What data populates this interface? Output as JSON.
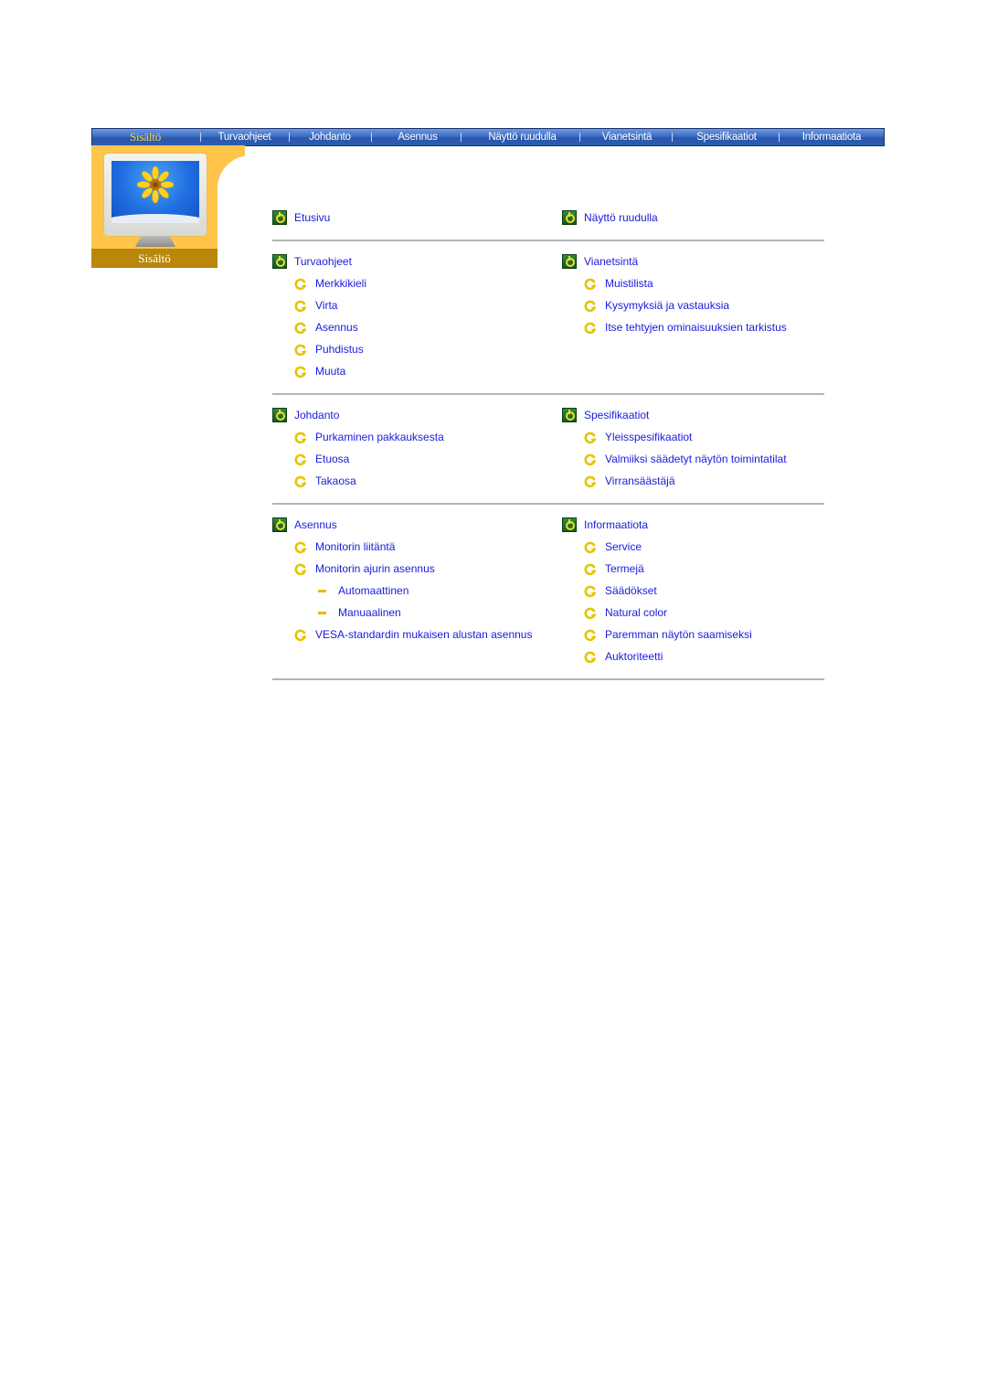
{
  "nav": {
    "items": [
      {
        "label": "Sisältö",
        "active": true
      },
      {
        "label": "Turvaohjeet",
        "active": false
      },
      {
        "label": "Johdanto",
        "active": false
      },
      {
        "label": "Asennus",
        "active": false
      },
      {
        "label": "Näyttö ruudulla",
        "active": false
      },
      {
        "label": "Vianetsintä",
        "active": false
      },
      {
        "label": "Spesifikaatiot",
        "active": false
      },
      {
        "label": "Informaatiota",
        "active": false
      }
    ]
  },
  "hero": {
    "label": "Sisältö",
    "image": "monitor-with-sunflower"
  },
  "colors": {
    "link": "#1a1adf",
    "nav_bg": "#2d5cb3",
    "nav_active": "#f6d33c",
    "hero_bg": "#ffc449",
    "hero_label_bg": "#b9870a",
    "divider": "#b4b4b4",
    "icon_green": "#1f7330",
    "icon_yellow": "#f5dd23"
  },
  "sections": [
    {
      "left": {
        "title": "Etusivu",
        "items": []
      },
      "right": {
        "title": "Näyttö ruudulla",
        "items": []
      }
    },
    {
      "left": {
        "title": "Turvaohjeet",
        "items": [
          {
            "label": "Merkkikieli",
            "level": 2
          },
          {
            "label": "Virta",
            "level": 2
          },
          {
            "label": "Asennus",
            "level": 2
          },
          {
            "label": "Puhdistus",
            "level": 2
          },
          {
            "label": "Muuta",
            "level": 2
          }
        ]
      },
      "right": {
        "title": "Vianetsintä",
        "items": [
          {
            "label": "Muistilista",
            "level": 2
          },
          {
            "label": "Kysymyksiä ja vastauksia",
            "level": 2
          },
          {
            "label": "Itse tehtyjen ominaisuuksien tarkistus",
            "level": 2
          }
        ]
      }
    },
    {
      "left": {
        "title": "Johdanto",
        "items": [
          {
            "label": "Purkaminen pakkauksesta",
            "level": 2
          },
          {
            "label": "Etuosa",
            "level": 2
          },
          {
            "label": "Takaosa",
            "level": 2
          }
        ]
      },
      "right": {
        "title": "Spesifikaatiot",
        "items": [
          {
            "label": "Yleisspesifikaatiot",
            "level": 2
          },
          {
            "label": "Valmiiksi säädetyt näytön toimintatilat",
            "level": 2
          },
          {
            "label": "Virransäästäjä",
            "level": 2
          }
        ]
      }
    },
    {
      "left": {
        "title": "Asennus",
        "items": [
          {
            "label": "Monitorin liitäntä",
            "level": 2
          },
          {
            "label": "Monitorin ajurin asennus",
            "level": 2
          },
          {
            "label": "Automaattinen",
            "level": 3
          },
          {
            "label": "Manuaalinen",
            "level": 3
          },
          {
            "label": "VESA-standardin mukaisen alustan asennus",
            "level": 2
          }
        ]
      },
      "right": {
        "title": "Informaatiota",
        "items": [
          {
            "label": "Service",
            "level": 2
          },
          {
            "label": "Termejä",
            "level": 2
          },
          {
            "label": "Säädökset",
            "level": 2
          },
          {
            "label": "Natural color",
            "level": 2
          },
          {
            "label": "Paremman näytön saamiseksi",
            "level": 2
          },
          {
            "label": "Auktoriteetti",
            "level": 2
          }
        ]
      }
    }
  ]
}
